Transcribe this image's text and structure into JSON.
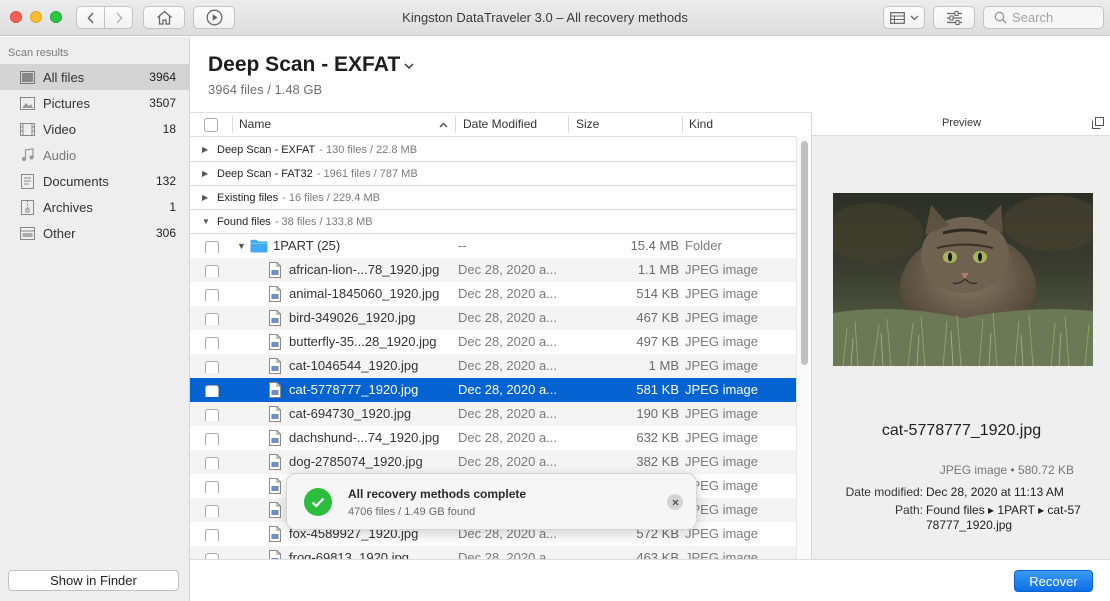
{
  "window": {
    "title": "Kingston DataTraveler 3.0 – All recovery methods",
    "search_placeholder": "Search"
  },
  "sidebar": {
    "heading": "Scan results",
    "items": [
      {
        "label": "All files",
        "count": "3964",
        "icon": "all-files-icon",
        "active": true
      },
      {
        "label": "Pictures",
        "count": "3507",
        "icon": "pictures-icon"
      },
      {
        "label": "Video",
        "count": "18",
        "icon": "video-icon"
      },
      {
        "label": "Audio",
        "count": "",
        "icon": "audio-icon"
      },
      {
        "label": "Documents",
        "count": "132",
        "icon": "documents-icon"
      },
      {
        "label": "Archives",
        "count": "1",
        "icon": "archives-icon"
      },
      {
        "label": "Other",
        "count": "306",
        "icon": "other-icon"
      }
    ],
    "show_in_finder": "Show in Finder"
  },
  "header": {
    "title": "Deep Scan - EXFAT",
    "subtitle": "3964 files / 1.48 GB"
  },
  "table": {
    "columns": [
      "Name",
      "Date Modified",
      "Size",
      "Kind"
    ],
    "groups": [
      {
        "name": "Deep Scan - EXFAT",
        "info": "- 130 files / 22.8 MB",
        "expanded": false
      },
      {
        "name": "Deep Scan - FAT32",
        "info": "- 1961 files / 787 MB",
        "expanded": false
      },
      {
        "name": "Existing files",
        "info": "- 16 files / 229.4 MB",
        "expanded": false
      },
      {
        "name": "Found files",
        "info": "- 38 files / 133.8 MB",
        "expanded": true
      }
    ],
    "folder": {
      "name": "1PART (25)",
      "date": "--",
      "size": "15.4 MB",
      "kind": "Folder"
    },
    "rows": [
      {
        "name": "african-lion-...78_1920.jpg",
        "date": "Dec 28, 2020 a...",
        "size": "1.1 MB",
        "kind": "JPEG image"
      },
      {
        "name": "animal-1845060_1920.jpg",
        "date": "Dec 28, 2020 a...",
        "size": "514 KB",
        "kind": "JPEG image"
      },
      {
        "name": "bird-349026_1920.jpg",
        "date": "Dec 28, 2020 a...",
        "size": "467 KB",
        "kind": "JPEG image"
      },
      {
        "name": "butterfly-35...28_1920.jpg",
        "date": "Dec 28, 2020 a...",
        "size": "497 KB",
        "kind": "JPEG image"
      },
      {
        "name": "cat-1046544_1920.jpg",
        "date": "Dec 28, 2020 a...",
        "size": "1 MB",
        "kind": "JPEG image"
      },
      {
        "name": "cat-5778777_1920.jpg",
        "date": "Dec 28, 2020 a...",
        "size": "581 KB",
        "kind": "JPEG image",
        "selected": true
      },
      {
        "name": "cat-694730_1920.jpg",
        "date": "Dec 28, 2020 a...",
        "size": "190 KB",
        "kind": "JPEG image"
      },
      {
        "name": "dachshund-...74_1920.jpg",
        "date": "Dec 28, 2020 a...",
        "size": "632 KB",
        "kind": "JPEG image"
      },
      {
        "name": "dog-2785074_1920.jpg",
        "date": "Dec 28, 2020 a...",
        "size": "382 KB",
        "kind": "JPEG image"
      },
      {
        "name": "",
        "date": "",
        "size": "",
        "kind": "JPEG image"
      },
      {
        "name": "",
        "date": "",
        "size": "",
        "kind": "JPEG image"
      },
      {
        "name": "fox-4589927_1920.jpg",
        "date": "Dec 28, 2020 a...",
        "size": "572 KB",
        "kind": "JPEG image"
      },
      {
        "name": "frog-69813_1920.jpg",
        "date": "Dec 28, 2020 a...",
        "size": "463 KB",
        "kind": "JPEG image"
      }
    ]
  },
  "toast": {
    "title": "All recovery methods complete",
    "subtitle": "4706 files / 1.49 GB found"
  },
  "preview": {
    "heading": "Preview",
    "filename": "cat-5778777_1920.jpg",
    "meta": "JPEG image • 580.72 KB",
    "date_label": "Date modified:",
    "date_value": "Dec 28, 2020 at 11:13 AM",
    "path_label": "Path:",
    "path_value": "Found files ▸ 1PART ▸ cat-5778777_1920.jpg"
  },
  "footer": {
    "recover_label": "Recover"
  },
  "colors": {
    "selection": "#0463d1",
    "accent": "#1a7ef0",
    "success": "#2dbd3d"
  }
}
